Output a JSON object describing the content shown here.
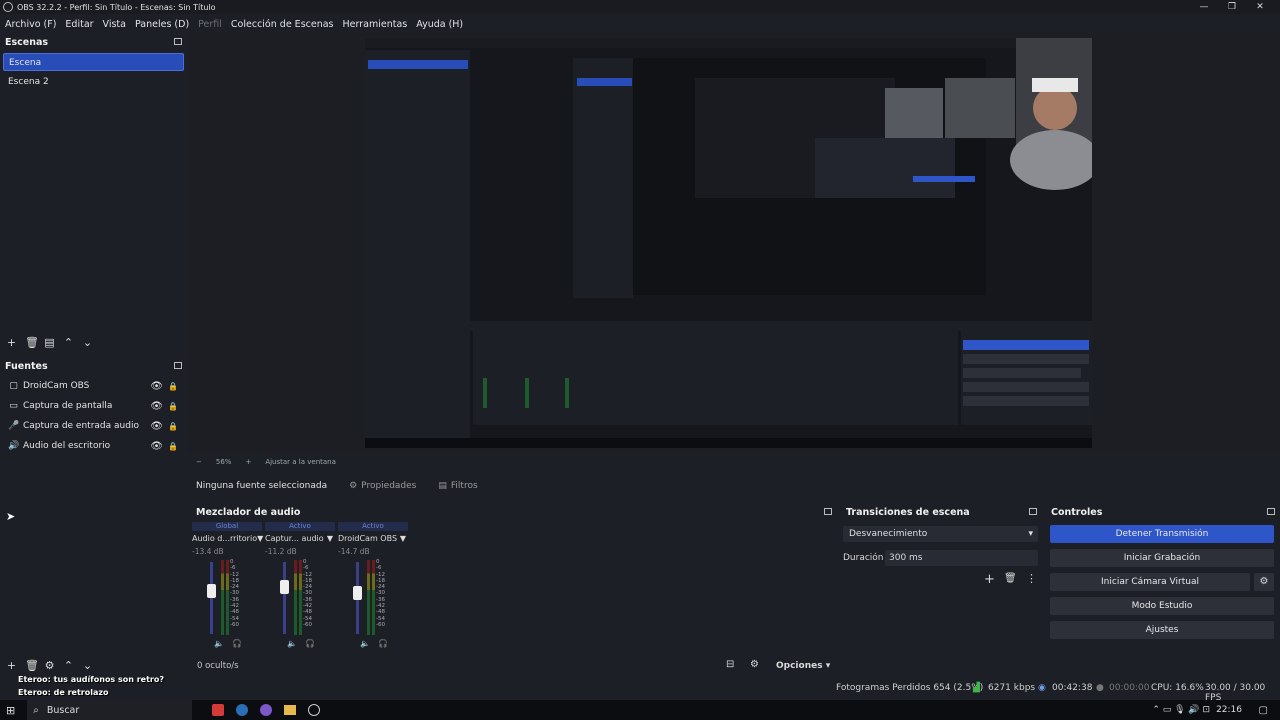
{
  "window": {
    "title": "OBS 32.2.2 - Perfil: Sin Título - Escenas: Sin Título",
    "minimize": "—",
    "maximize": "❐",
    "close": "✕"
  },
  "menu": [
    "Archivo (F)",
    "Editar",
    "Vista",
    "Paneles (D)",
    "Perfil",
    "Colección de Escenas",
    "Herramientas",
    "Ayuda (H)"
  ],
  "scenes": {
    "title": "Escenas",
    "items": [
      "Escena",
      "Escena 2"
    ],
    "selected_index": 0
  },
  "sources": {
    "title": "Fuentes",
    "items": [
      {
        "label": "DroidCam OBS",
        "icon": "camera-icon"
      },
      {
        "label": "Captura de pantalla",
        "icon": "monitor-icon"
      },
      {
        "label": "Captura de entrada audio",
        "icon": "microphone-icon"
      },
      {
        "label": "Audio del escritorio",
        "icon": "speaker-icon"
      }
    ]
  },
  "preview": {
    "zoom": "56%",
    "fit_label": "Ajustar a la ventana"
  },
  "propbar": {
    "no_source": "Ninguna fuente seleccionada",
    "properties": "Propiedades",
    "filters": "Filtros"
  },
  "mixer": {
    "title": "Mezclador de audio",
    "channels": [
      {
        "header": "Global",
        "name": "Audio d...rritorio",
        "db": "-13.4 dB",
        "level": 0.35
      },
      {
        "header": "Activo",
        "name": "Captur... audio",
        "db": "-11.2 dB",
        "level": 0.45
      },
      {
        "header": "Activo",
        "name": "DroidCam OBS",
        "db": "-14.7 dB",
        "level": 0.3
      }
    ],
    "scale": [
      "0",
      "-6",
      "-12",
      "-18",
      "-24",
      "-30",
      "-36",
      "-42",
      "-48",
      "-54",
      "-60"
    ],
    "hidden": "0 oculto/s",
    "options": "Opciones"
  },
  "transitions": {
    "title": "Transiciones de escena",
    "selected": "Desvanecimiento",
    "duration_label": "Duración",
    "duration_value": "300 ms"
  },
  "controls": {
    "title": "Controles",
    "buttons": [
      "Detener Transmisión",
      "Iniciar Grabación",
      "Iniciar Cámara Virtual",
      "Modo Estudio",
      "Ajustes"
    ]
  },
  "overlay": {
    "line1": "Eteroo: tus audífonos son retro?",
    "line2": "Eteroo: de retrolazo"
  },
  "status": {
    "dropped": "Fotogramas Perdidos 654 (2.5%)",
    "bitrate": "6271 kbps",
    "stream_time": "00:42:38",
    "rec_time": "00:00:00",
    "cpu": "CPU: 16.6%",
    "fps": "30.00 / 30.00 FPS"
  },
  "taskbar": {
    "search": "Buscar",
    "time": "22:16"
  },
  "colors": {
    "accent": "#2f56c8",
    "panel": "#1d1f26",
    "button": "#2d3039"
  }
}
